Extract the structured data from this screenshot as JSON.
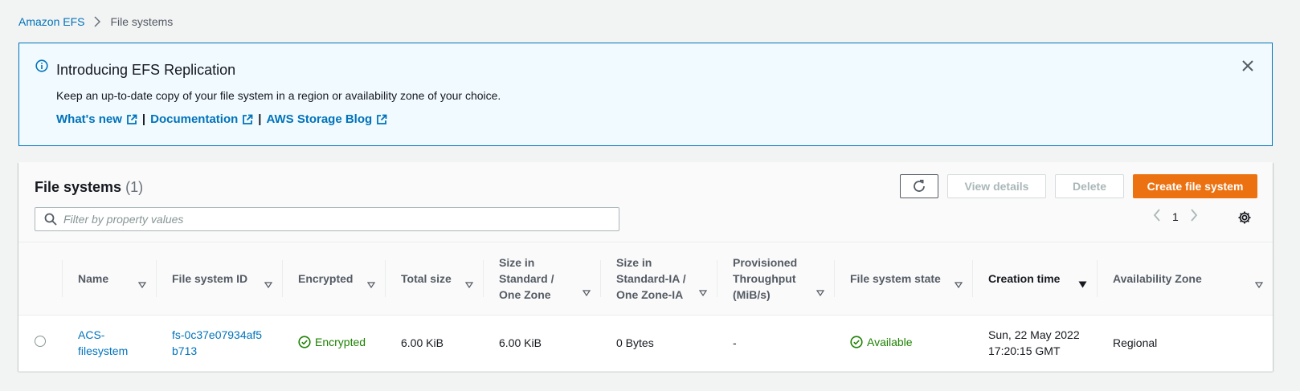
{
  "breadcrumb": {
    "root": "Amazon EFS",
    "current": "File systems"
  },
  "banner": {
    "title": "Introducing EFS Replication",
    "body": "Keep an up-to-date copy of your file system in a region or availability zone of your choice.",
    "links": [
      "What's new",
      "Documentation",
      "AWS Storage Blog"
    ],
    "separator": "|"
  },
  "panel": {
    "title": "File systems",
    "count": "(1)",
    "buttons": {
      "view": "View details",
      "delete": "Delete",
      "create": "Create file system"
    },
    "search_placeholder": "Filter by property values",
    "page": "1"
  },
  "table": {
    "columns": [
      "Name",
      "File system ID",
      "Encrypted",
      "Total size",
      "Size in Standard / One Zone",
      "Size in Standard-IA / One Zone-IA",
      "Provisioned Throughput (MiB/s)",
      "File system state",
      "Creation time",
      "Availability Zone"
    ],
    "rows": [
      {
        "name": "ACS-filesystem",
        "id": "fs-0c37e07934af5b713",
        "encrypted": "Encrypted",
        "total_size": "6.00 KiB",
        "size_standard": "6.00 KiB",
        "size_ia": "0 Bytes",
        "throughput": "-",
        "state": "Available",
        "creation_time": "Sun, 22 May 2022 17:20:15 GMT",
        "az": "Regional"
      }
    ]
  },
  "colors": {
    "link": "#0073bb",
    "primary_button": "#ec7211",
    "success": "#1d8102",
    "banner_bg": "#f1faff"
  }
}
